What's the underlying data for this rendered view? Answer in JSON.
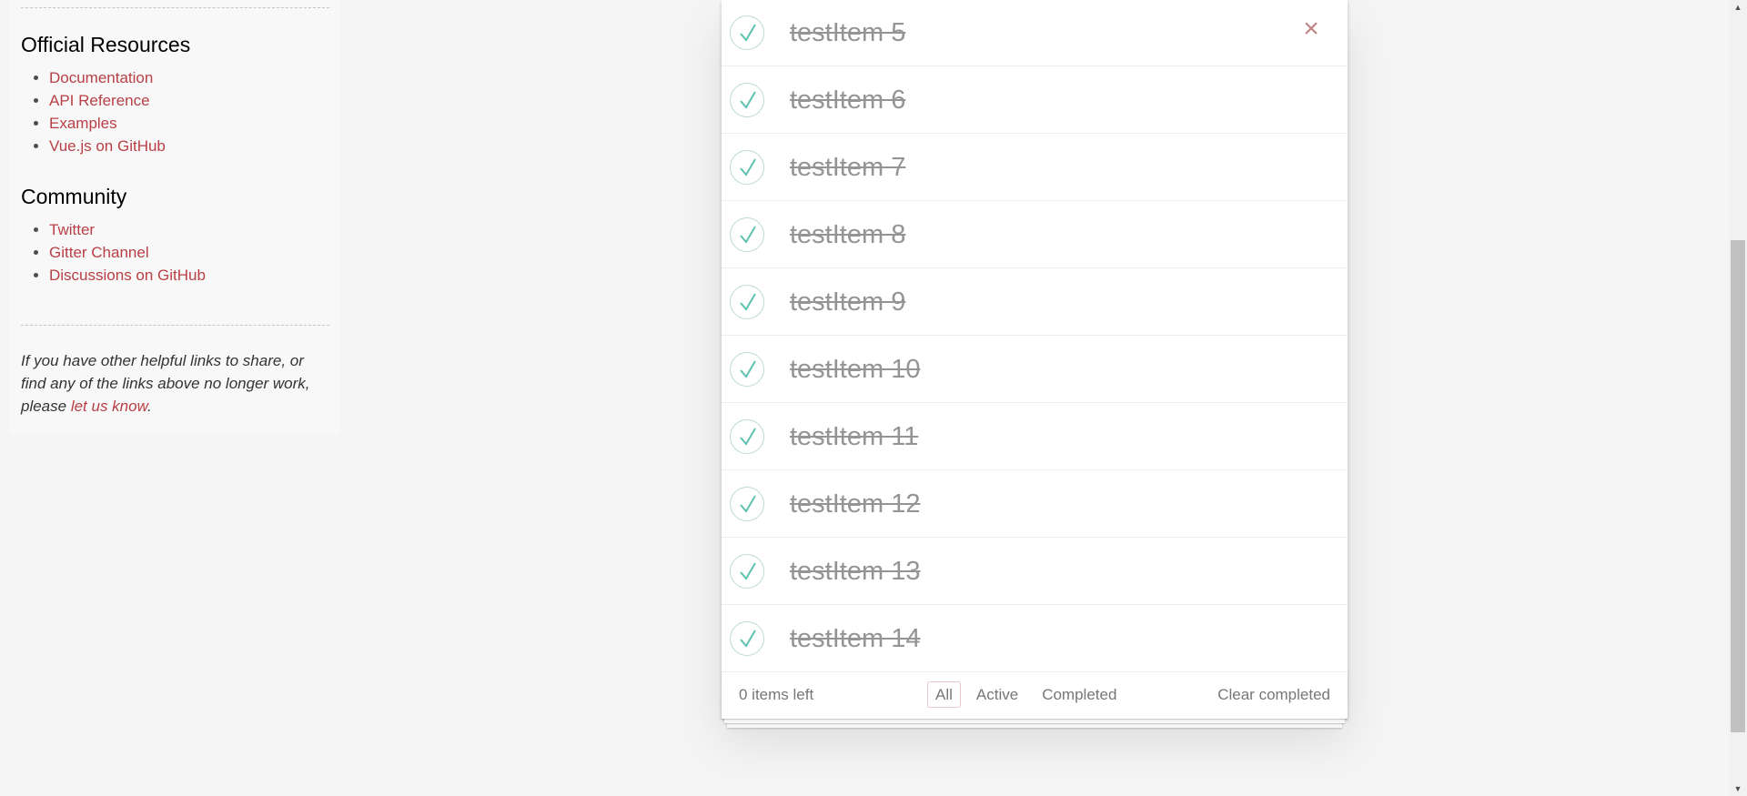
{
  "sidebar": {
    "official_resources": {
      "title": "Official Resources",
      "links": [
        "Documentation",
        "API Reference",
        "Examples",
        "Vue.js on GitHub"
      ]
    },
    "community": {
      "title": "Community",
      "links": [
        "Twitter",
        "Gitter Channel",
        "Discussions on GitHub"
      ]
    },
    "footer_note": {
      "before": "If you have other helpful links to share, or find any of the links above no longer work, please ",
      "link": "let us know",
      "after": "."
    }
  },
  "todos": {
    "items": [
      {
        "label": "testItem 5",
        "completed": true
      },
      {
        "label": "testItem 6",
        "completed": true
      },
      {
        "label": "testItem 7",
        "completed": true
      },
      {
        "label": "testItem 8",
        "completed": true
      },
      {
        "label": "testItem 9",
        "completed": true
      },
      {
        "label": "testItem 10",
        "completed": true
      },
      {
        "label": "testItem 11",
        "completed": true
      },
      {
        "label": "testItem 12",
        "completed": true
      },
      {
        "label": "testItem 13",
        "completed": true
      },
      {
        "label": "testItem 14",
        "completed": true
      }
    ],
    "destroy_icon": "×",
    "footer": {
      "count": "0 items left",
      "filters": [
        "All",
        "Active",
        "Completed"
      ],
      "selected_filter": "All",
      "clear_completed": "Clear completed"
    }
  },
  "colors": {
    "link": "#b83f45",
    "check": "#5dc2af",
    "completed_text": "#949494",
    "destroy": "#c18585"
  },
  "icons": {
    "toggle": "check-icon",
    "destroy": "close-icon",
    "scroll_up": "arrow-up-icon",
    "scroll_down": "arrow-down-icon"
  }
}
